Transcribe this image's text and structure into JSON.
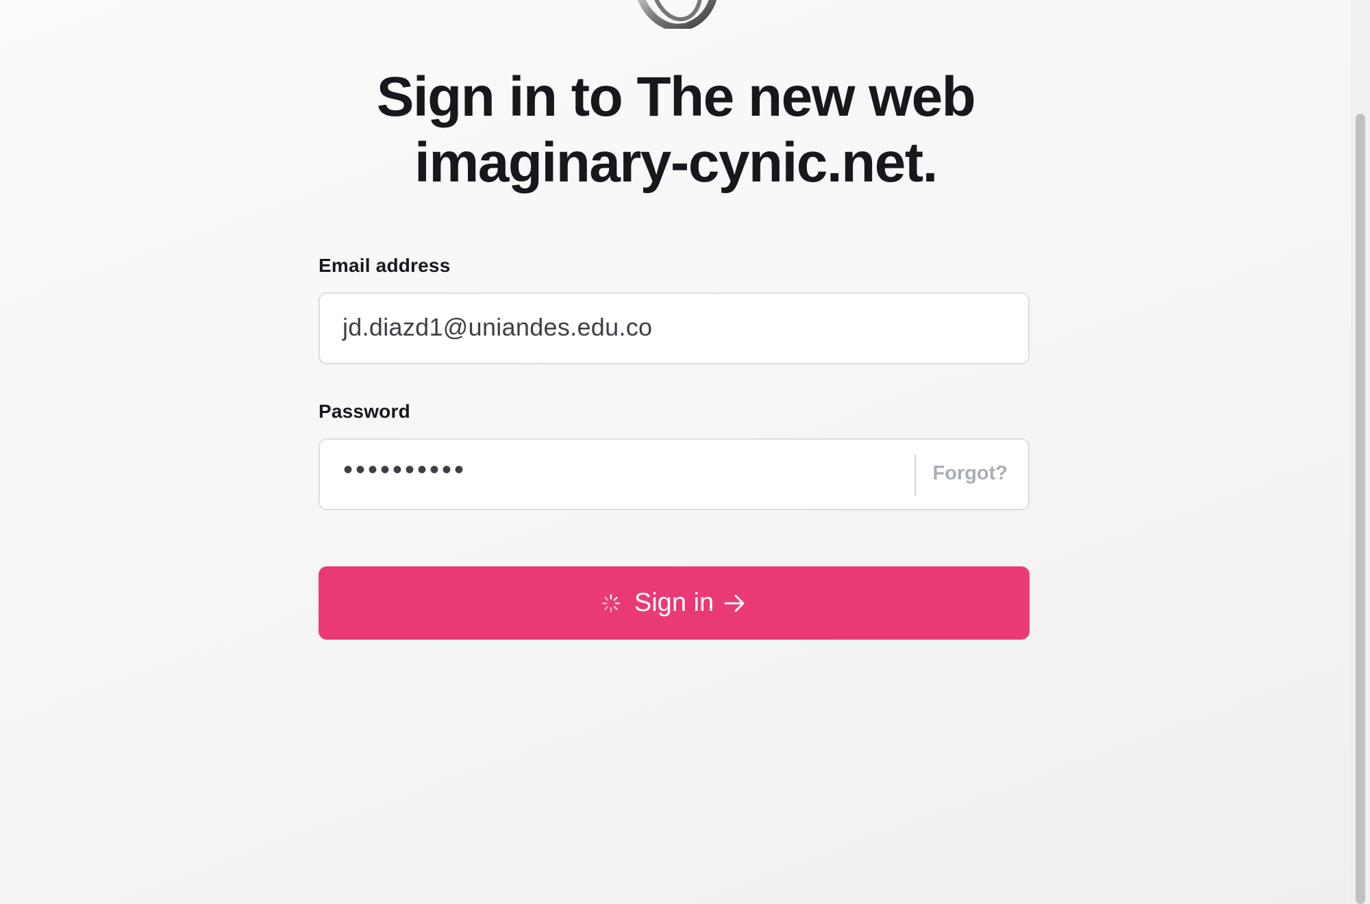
{
  "header": {
    "logo_icon": "stone-ring-logo",
    "title_line1": "Sign in to The new web",
    "title_line2": "imaginary-cynic.net."
  },
  "form": {
    "email": {
      "label": "Email address",
      "value": "jd.diazd1@uniandes.edu.co"
    },
    "password": {
      "label": "Password",
      "masked_value": "••••••••••",
      "forgot_label": "Forgot?"
    },
    "submit": {
      "label": "Sign in",
      "loading_icon": "spinner-icon",
      "arrow_icon": "arrow-right-icon",
      "color": "#e93a76"
    }
  }
}
